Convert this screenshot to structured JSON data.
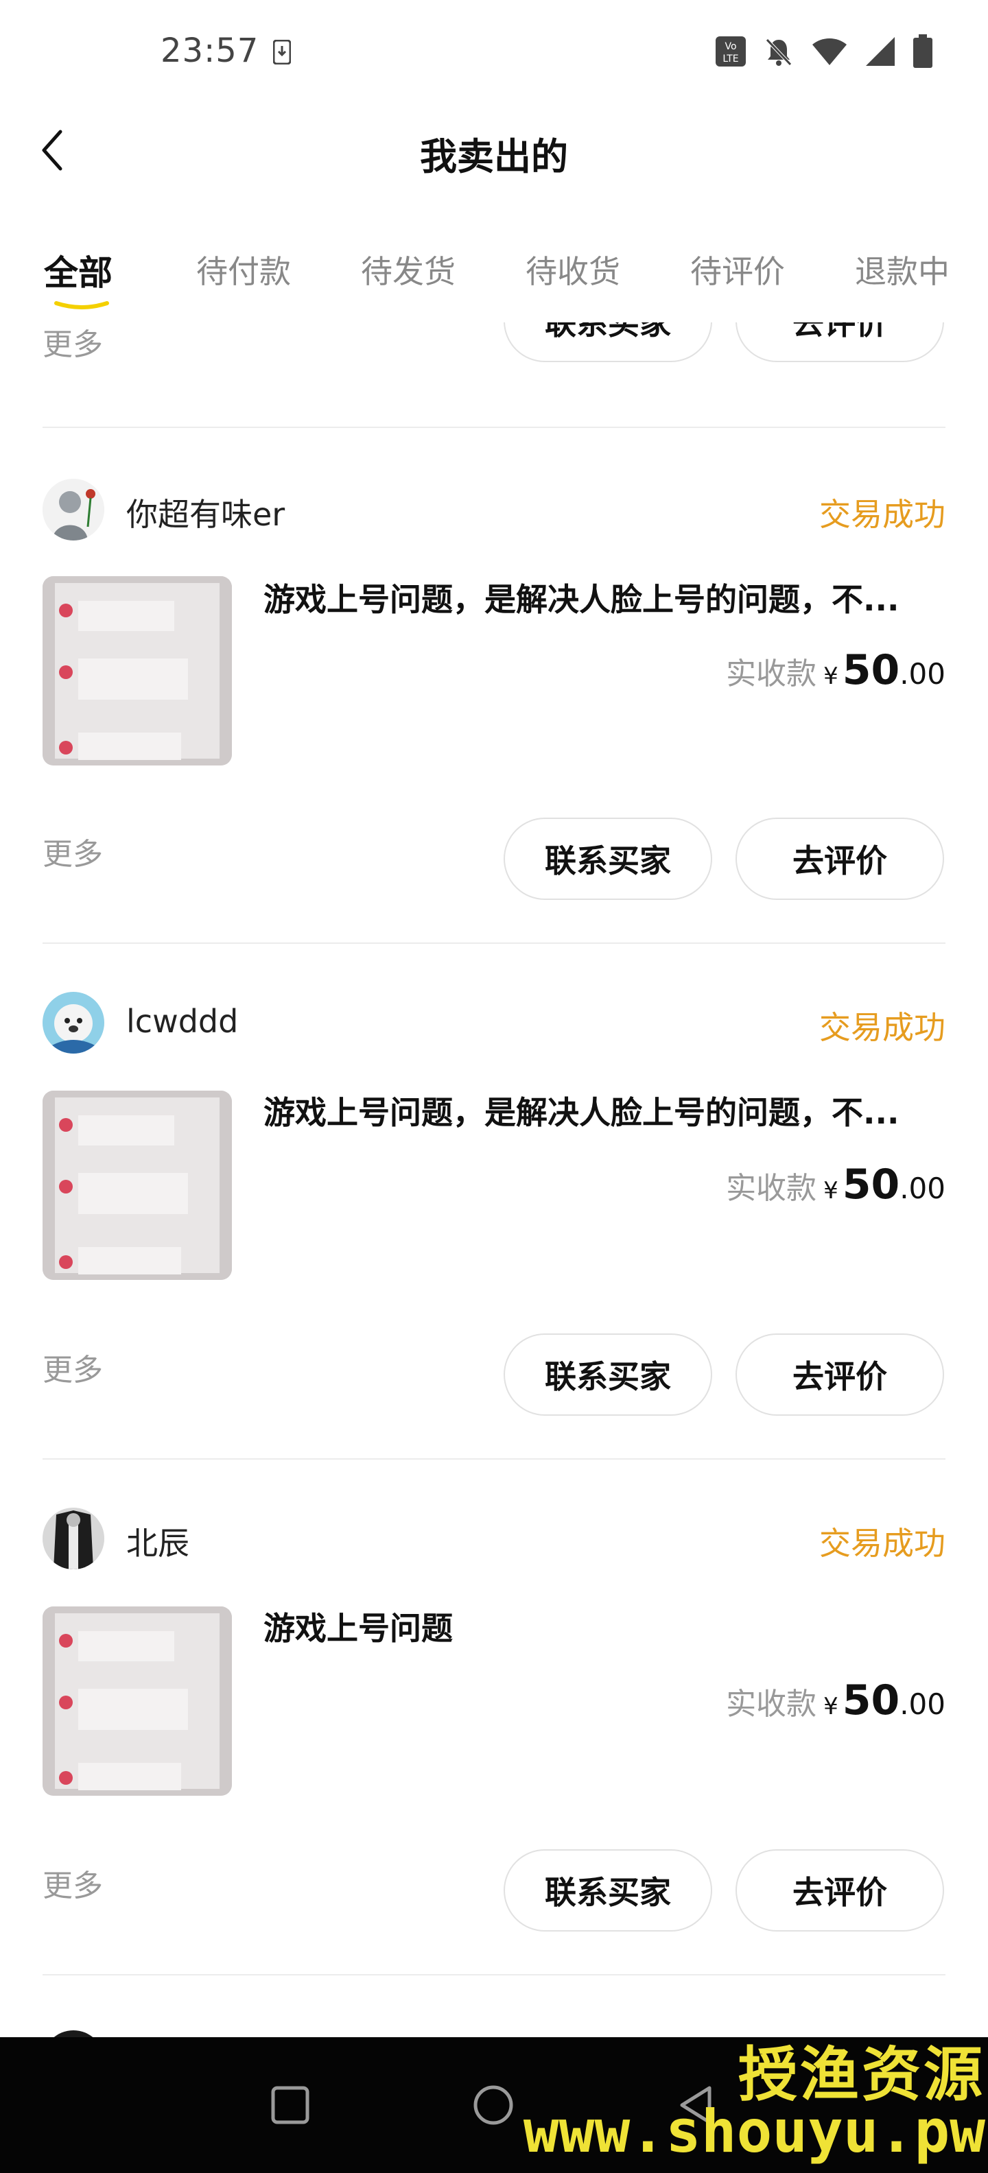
{
  "status_bar": {
    "time": "23:57",
    "icons": [
      "download-notification-icon",
      "volte-icon",
      "silent-bell-icon",
      "wifi-icon",
      "signal-icon",
      "battery-icon"
    ]
  },
  "header": {
    "title": "我卖出的",
    "back_icon": "chevron-left-icon"
  },
  "tabs": [
    {
      "label": "全部",
      "active": true
    },
    {
      "label": "待付款",
      "active": false
    },
    {
      "label": "待发货",
      "active": false
    },
    {
      "label": "待收货",
      "active": false
    },
    {
      "label": "待评价",
      "active": false
    },
    {
      "label": "退款中",
      "active": false
    }
  ],
  "accent_color": "#f4d000",
  "status_color": "#e69c1f",
  "partial_card": {
    "more_label": "更多",
    "contact_label": "联系买家",
    "review_label": "去评价"
  },
  "orders": [
    {
      "buyer": "你超有味er",
      "status": "交易成功",
      "title": "游戏上号问题，是解决人脸上号的问题，不...",
      "price_label": "实收款",
      "currency": "¥",
      "price_int": "50",
      "price_dec": ".00",
      "more_label": "更多",
      "contact_label": "联系买家",
      "review_label": "去评价"
    },
    {
      "buyer": "lcwddd",
      "status": "交易成功",
      "title": "游戏上号问题，是解决人脸上号的问题，不...",
      "price_label": "实收款",
      "currency": "¥",
      "price_int": "50",
      "price_dec": ".00",
      "more_label": "更多",
      "contact_label": "联系买家",
      "review_label": "去评价"
    },
    {
      "buyer": "北辰",
      "status": "交易成功",
      "title": "游戏上号问题",
      "price_label": "实收款",
      "currency": "¥",
      "price_int": "50",
      "price_dec": ".00",
      "more_label": "更多",
      "contact_label": "联系买家",
      "review_label": "去评价"
    }
  ],
  "nav_bar": {
    "icons": [
      "recents-square-icon",
      "home-circle-icon",
      "back-triangle-icon"
    ]
  },
  "watermark": {
    "text": "授渔资源",
    "url": "www.shouyu.pw"
  }
}
